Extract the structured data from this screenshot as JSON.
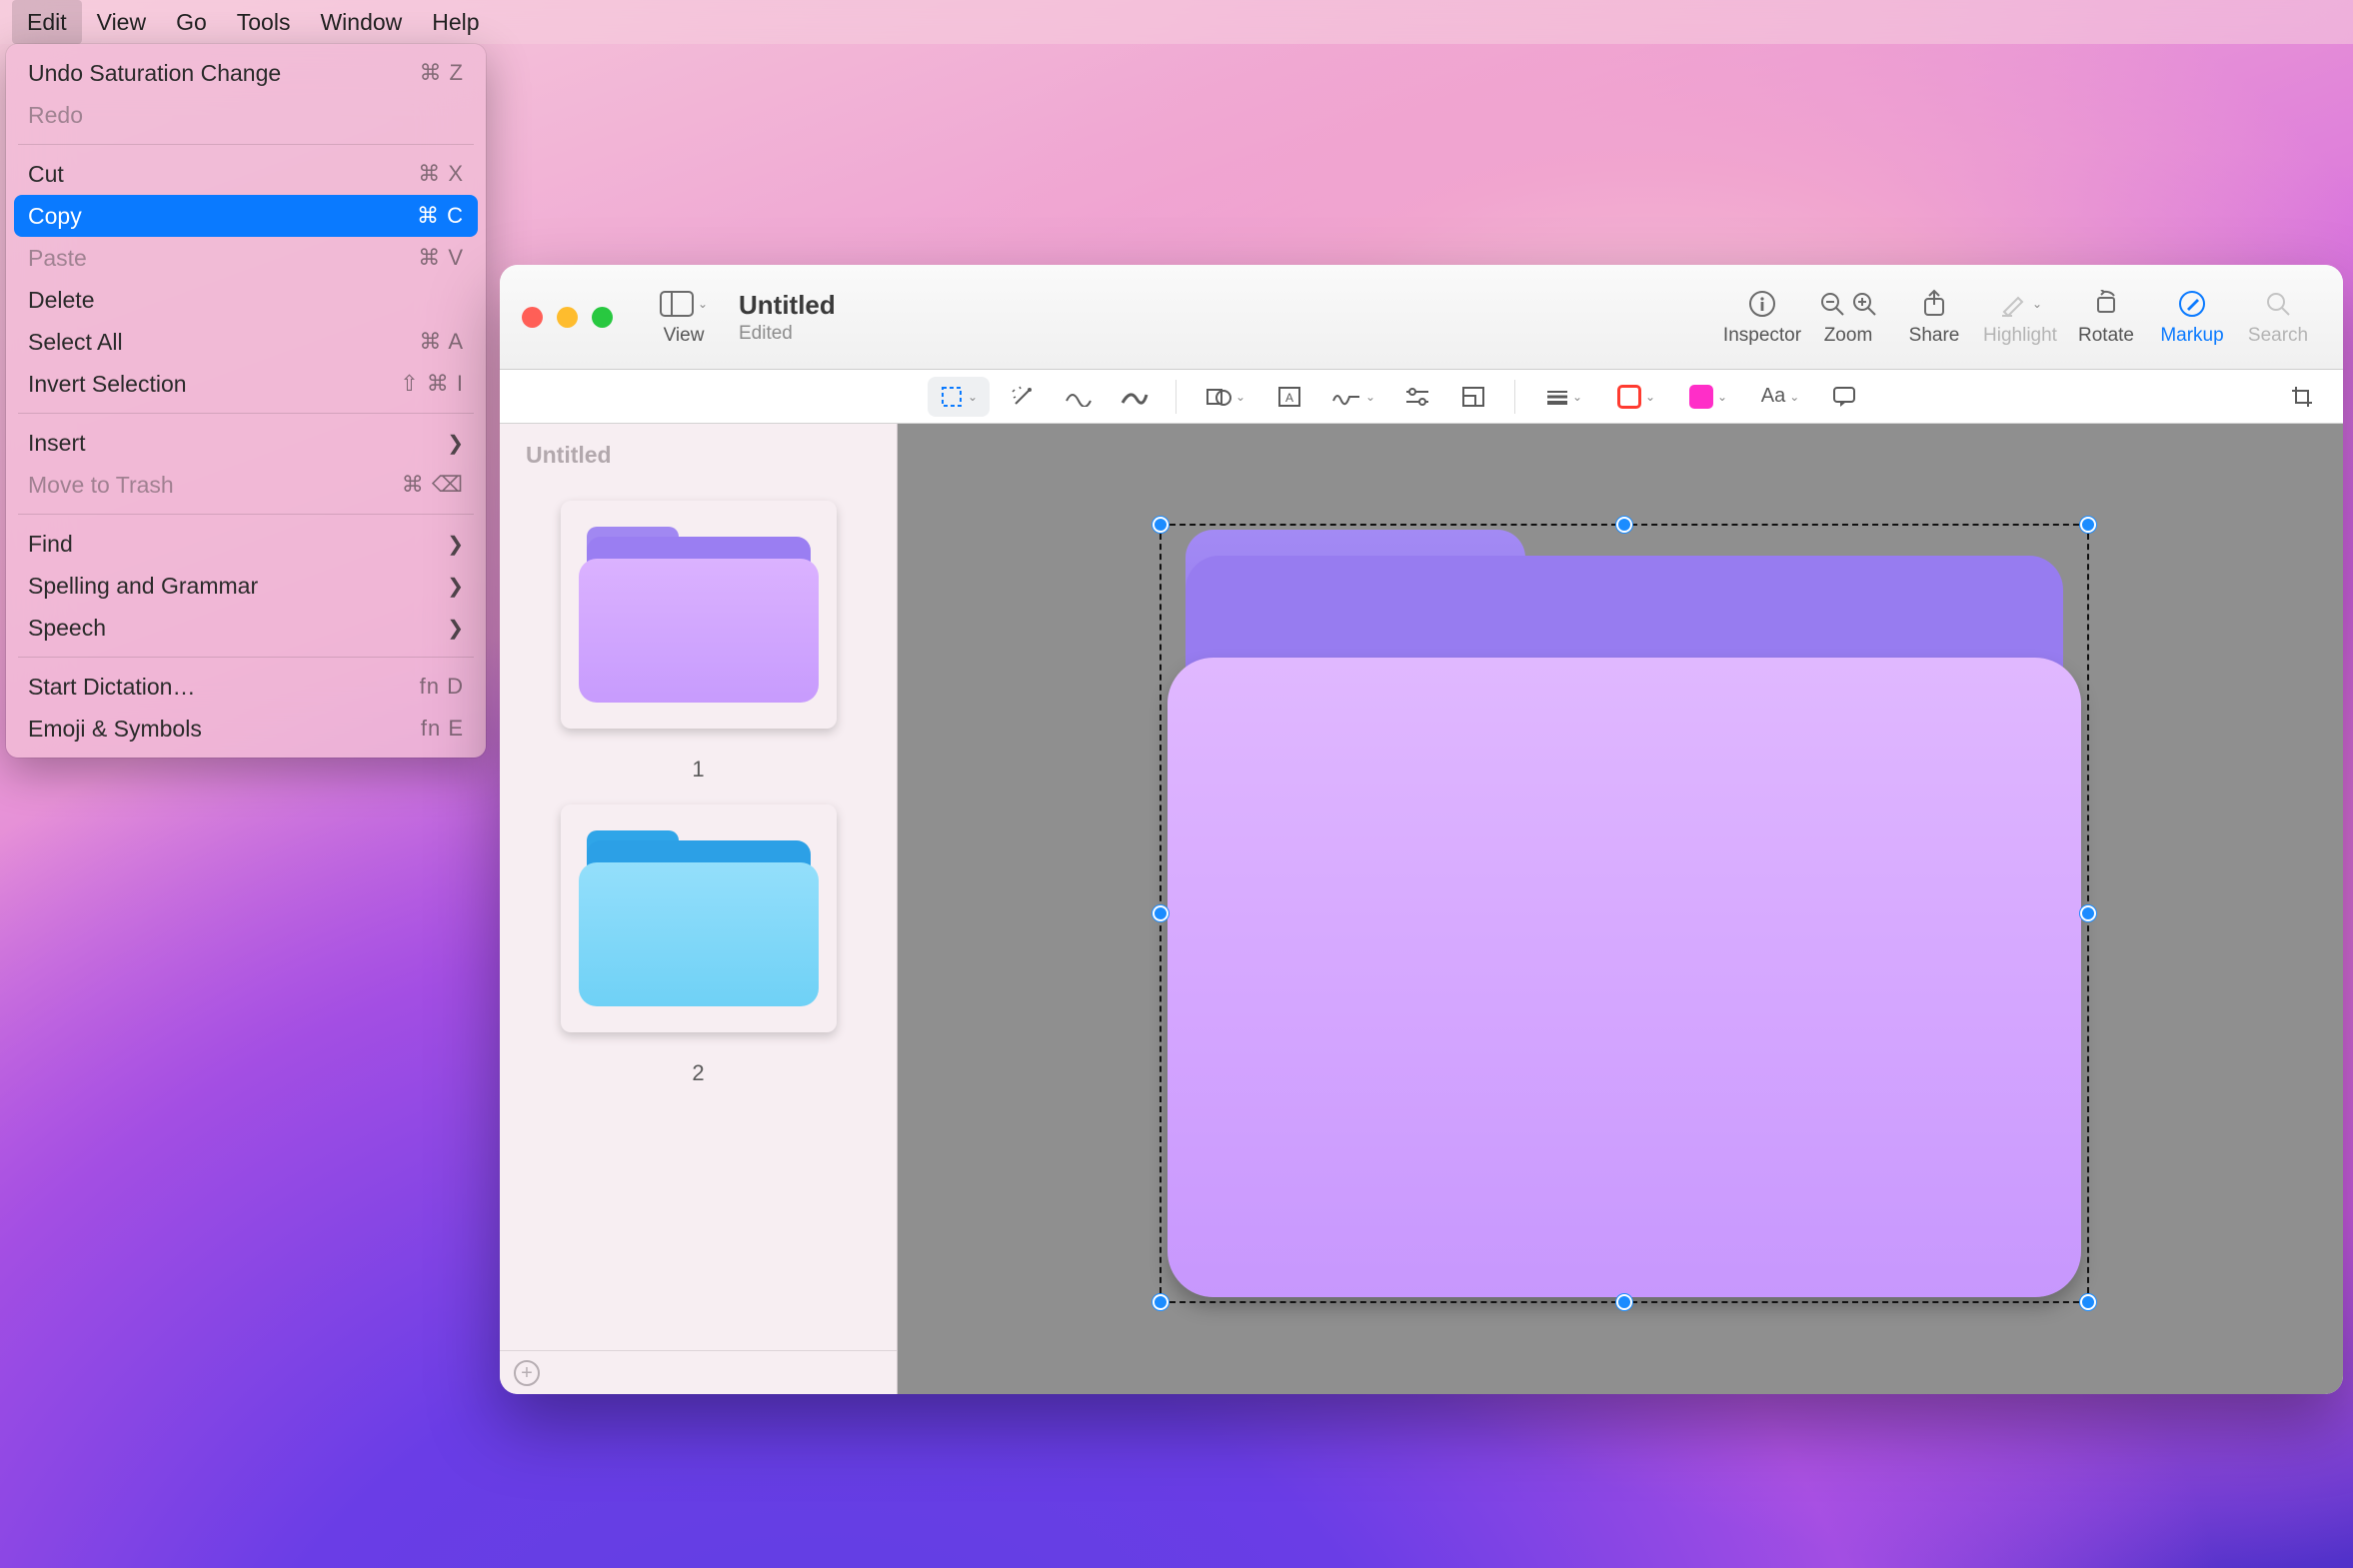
{
  "menubar": {
    "items": [
      "Edit",
      "View",
      "Go",
      "Tools",
      "Window",
      "Help"
    ],
    "open_index": 0
  },
  "dropdown": {
    "groups": [
      [
        {
          "label": "Undo Saturation Change",
          "shortcut": "⌘ Z",
          "disabled": false
        },
        {
          "label": "Redo",
          "shortcut": "",
          "disabled": true
        }
      ],
      [
        {
          "label": "Cut",
          "shortcut": "⌘ X",
          "disabled": false
        },
        {
          "label": "Copy",
          "shortcut": "⌘ C",
          "disabled": false,
          "highlighted": true
        },
        {
          "label": "Paste",
          "shortcut": "⌘ V",
          "disabled": true
        },
        {
          "label": "Delete",
          "shortcut": "",
          "disabled": false
        },
        {
          "label": "Select All",
          "shortcut": "⌘ A",
          "disabled": false
        },
        {
          "label": "Invert Selection",
          "shortcut": "⇧ ⌘  I",
          "disabled": false
        }
      ],
      [
        {
          "label": "Insert",
          "submenu": true,
          "disabled": false
        },
        {
          "label": "Move to Trash",
          "shortcut": "⌘ ⌫",
          "disabled": true
        }
      ],
      [
        {
          "label": "Find",
          "submenu": true,
          "disabled": false
        },
        {
          "label": "Spelling and Grammar",
          "submenu": true,
          "disabled": false
        },
        {
          "label": "Speech",
          "submenu": true,
          "disabled": false
        }
      ],
      [
        {
          "label": "Start Dictation…",
          "shortcut": "fn D",
          "disabled": false
        },
        {
          "label": "Emoji & Symbols",
          "shortcut": "fn E",
          "disabled": false
        }
      ]
    ]
  },
  "window": {
    "title": "Untitled",
    "subtitle": "Edited",
    "toolbar": {
      "view": "View",
      "inspector": "Inspector",
      "zoom": "Zoom",
      "share": "Share",
      "highlight": "Highlight",
      "rotate": "Rotate",
      "markup": "Markup",
      "search": "Search"
    },
    "sidebar": {
      "heading": "Untitled",
      "pages": [
        {
          "label": "1",
          "color": "purple"
        },
        {
          "label": "2",
          "color": "blue"
        }
      ]
    },
    "markup_tools": {
      "text_style": "Aa",
      "border_color": "#ff3b30",
      "fill_color": "#ff2ec8"
    }
  }
}
